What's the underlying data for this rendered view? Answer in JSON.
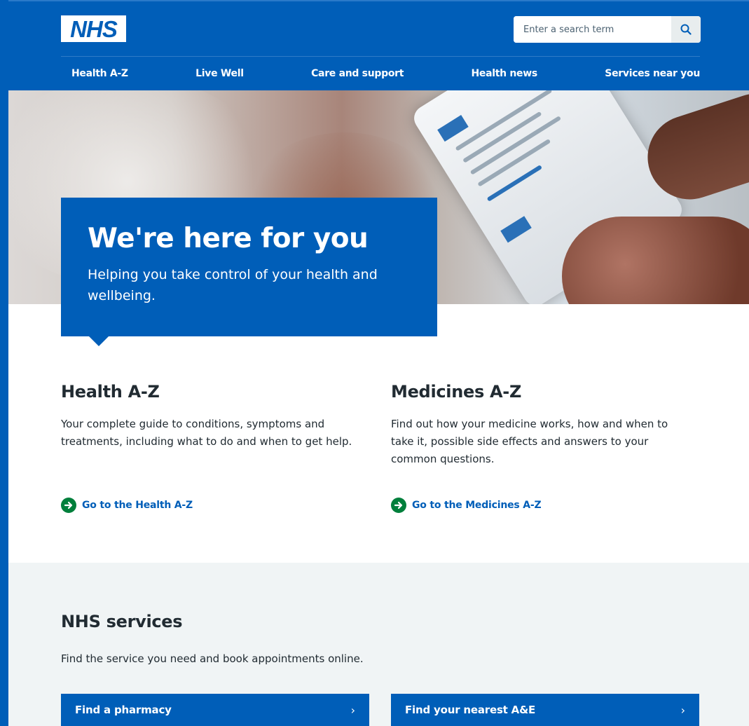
{
  "header": {
    "logo_text": "NHS",
    "search": {
      "placeholder": "Enter a search term",
      "button_icon": "search-icon"
    },
    "nav": [
      {
        "label": "Health A-Z"
      },
      {
        "label": "Live Well"
      },
      {
        "label": "Care and support"
      },
      {
        "label": "Health news"
      },
      {
        "label": "Services near you"
      }
    ]
  },
  "hero": {
    "title": "We're here for you",
    "subtitle": "Helping you take control of your health and wellbeing."
  },
  "az": [
    {
      "title": "Health A-Z",
      "description": "Your complete guide to conditions, symptoms and treatments, including what to do and when to get help.",
      "link": "Go to the Health A-Z"
    },
    {
      "title": "Medicines A-Z",
      "description": "Find out how your medicine works, how and when to take it, possible side effects and answers to your common questions.",
      "link": "Go to the Medicines A-Z"
    }
  ],
  "services": {
    "title": "NHS services",
    "description": "Find the service you need and book appointments online.",
    "buttons": [
      {
        "label": "Find a pharmacy",
        "icon": "chevron-right-icon"
      },
      {
        "label": "Find your nearest A&E",
        "icon": "chevron-right-icon"
      }
    ]
  },
  "colors": {
    "nhs_blue": "#005eb8",
    "link_arrow_green": "#007f3b",
    "text": "#212b32",
    "section_grey": "#f0f4f5"
  }
}
